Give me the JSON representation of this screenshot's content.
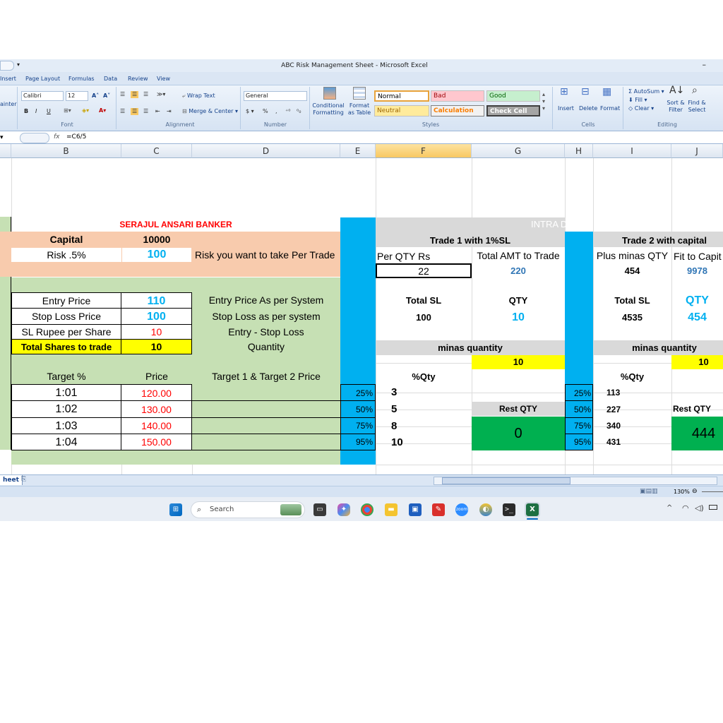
{
  "window": {
    "title": "ABC Risk Management Sheet - Microsoft Excel",
    "qa": "⁼ ▾ ǂ"
  },
  "ribbon_tabs": [
    "Insert",
    "Page Layout",
    "Formulas",
    "Data",
    "Review",
    "View"
  ],
  "ribbon": {
    "clipboard_partial": "ainter",
    "font_name": "Calibri",
    "font_size": "12",
    "wrap_text": "Wrap Text",
    "merge_center": "Merge & Center",
    "number_format": "General",
    "conditional_formatting": "Conditional Formatting",
    "format_as_table": "Format as Table",
    "styles": [
      {
        "label": "Normal",
        "bg": "#ffffff",
        "fg": "#000000"
      },
      {
        "label": "Bad",
        "bg": "#ffc7ce",
        "fg": "#9c0006"
      },
      {
        "label": "Good",
        "bg": "#c6efce",
        "fg": "#006100"
      },
      {
        "label": "Neutral",
        "bg": "#ffeb9c",
        "fg": "#9c6500"
      },
      {
        "label": "Calculation",
        "bg": "#f2f2f2",
        "fg": "#fa7d00"
      },
      {
        "label": "Check Cell",
        "bg": "#a5a5a5",
        "fg": "#ffffff"
      }
    ],
    "cells_buttons": [
      "Insert",
      "Delete",
      "Format"
    ],
    "autosum": "AutoSum",
    "fill": "Fill",
    "clear": "Clear",
    "sort_filter": "Sort & Filter",
    "find_select": "Find & Select",
    "group_labels": {
      "font": "Font",
      "alignment": "Alignment",
      "number": "Number",
      "styles": "Styles",
      "cells": "Cells",
      "editing": "Editing"
    }
  },
  "formula_bar": {
    "fx": "fx",
    "formula": "=C6/5"
  },
  "columns": [
    "B",
    "C",
    "D",
    "E",
    "F",
    "G",
    "H",
    "I",
    "J"
  ],
  "sheet": {
    "title": "SERAJUL ANSARI BANKER",
    "capital_label": "Capital",
    "capital_value": "10000",
    "risk_label": "Risk  .5%",
    "risk_value": "100",
    "risk_desc": "Risk you want to take Per Trade",
    "entry_label": "Entry Price",
    "entry_value": "110",
    "entry_desc": "Entry Price As per System",
    "sl_label": "Stop Loss Price",
    "sl_value": "100",
    "sl_desc": "Stop Loss as per system",
    "slrs_label": "SL Rupee per Share",
    "slrs_value": "10",
    "slrs_desc": "Entry - Stop Loss",
    "shares_label": "Total Shares to trade",
    "shares_value": "10",
    "shares_desc": "Quantity",
    "target_pct_label": "Target %",
    "price_label": "Price",
    "target_desc": "Target 1  & Target 2 Price",
    "targets": [
      {
        "ratio": "1:01",
        "price": "120.00",
        "pct": "25%"
      },
      {
        "ratio": "1:02",
        "price": "130.00",
        "pct": "50%"
      },
      {
        "ratio": "1:03",
        "price": "140.00",
        "pct": "75%"
      },
      {
        "ratio": "1:04",
        "price": "150.00",
        "pct": "95%"
      }
    ],
    "intraday": "INTRA DAY",
    "trade1": {
      "header": "Trade 1 with 1%SL",
      "per_qty_label": "Per QTY  Rs",
      "total_amt_label": "Total AMT to Trade",
      "per_qty": "22",
      "total_amt": "220",
      "total_sl_label": "Total SL",
      "qty_label": "QTY",
      "total_sl": "100",
      "qty": "10",
      "minas_label": "minas quantity",
      "minas": "10",
      "pctqty_label": "%Qty",
      "pct_qty": [
        "3",
        "5",
        "8",
        "10"
      ],
      "rest_label": "Rest QTY",
      "rest": "0"
    },
    "trade2": {
      "header": "Trade 2 with capital",
      "plus_label": "Plus minas QTY",
      "fit_label": "Fit to Capit",
      "plus": "454",
      "fit": "9978",
      "total_sl_label": "Total SL",
      "qty_label": "QTY",
      "total_sl": "4535",
      "qty": "454",
      "minas_label": "minas quantity",
      "minas": "10",
      "pctqty_label": "%Qty",
      "pct_qty": [
        "113",
        "227",
        "340",
        "431"
      ],
      "rest_label": "Rest QTY",
      "rest": "444"
    }
  },
  "sheet_tab": "heet",
  "zoom": "130%",
  "taskbar": {
    "search_placeholder": "Search"
  },
  "colors": {
    "peach": "#f8cbad",
    "green": "#c6e0b4",
    "cyan": "#00b0f0",
    "grey": "#d9d9d9",
    "yellow": "#ffff00",
    "rest_green": "#00b050",
    "red": "#ff0000",
    "blue_text": "#00b0f0",
    "dark_blue": "#2f75b5"
  }
}
